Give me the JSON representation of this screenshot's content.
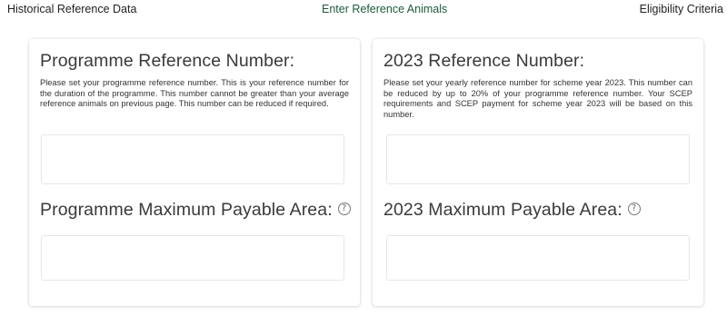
{
  "steps": {
    "historical": "Historical Reference Data",
    "enter": "Enter Reference Animals",
    "eligibility": "Eligibility Criteria"
  },
  "programme": {
    "ref_heading": "Programme Reference Number:",
    "ref_description": "Please set your programme reference number. This is your reference number for the duration of the programme. This number cannot be greater than your average reference animals on previous page. This number can be reduced if required.",
    "ref_value": "",
    "area_heading": "Programme Maximum Payable Area:",
    "area_value": ""
  },
  "year2023": {
    "ref_heading": "2023 Reference Number:",
    "ref_description": "Please set your yearly reference number for scheme year 2023. This number can be reduced by up to 20% of your programme reference number. Your SCEP requirements and SCEP payment for scheme year 2023 will be based on this number.",
    "ref_value": "",
    "area_heading": "2023 Maximum Payable Area:",
    "area_value": ""
  },
  "icons": {
    "help": "help-circle-icon",
    "help_glyph": "?"
  },
  "colors": {
    "active_step": "#1e5a3c",
    "heading": "#3a3a3a",
    "field_border": "#e6e6e6"
  }
}
